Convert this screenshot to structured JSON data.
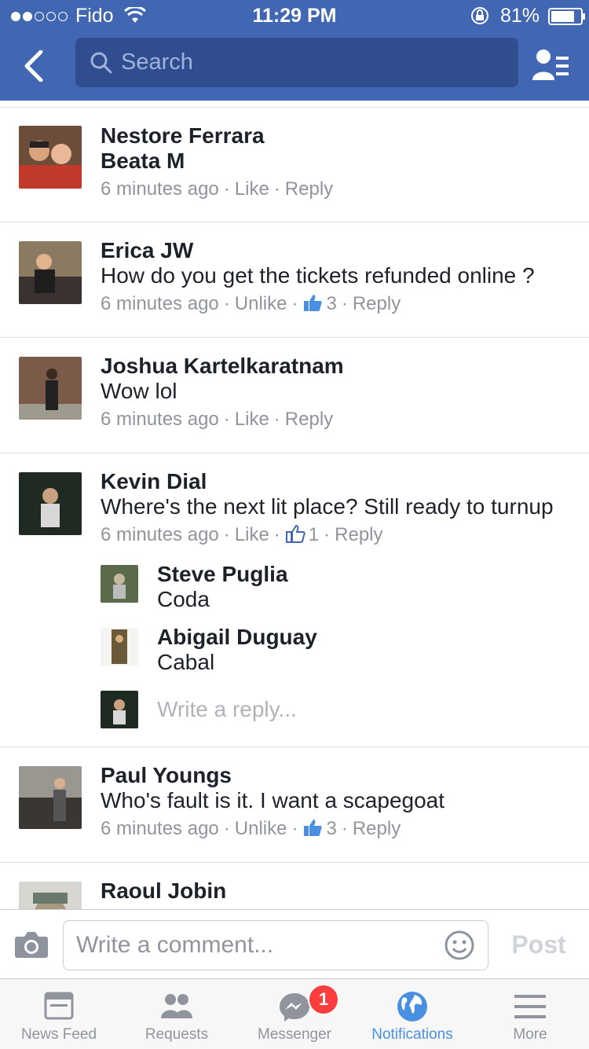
{
  "status_bar": {
    "carrier": "Fido",
    "time": "11:29 PM",
    "battery_percent": "81%",
    "battery_level": 0.81,
    "signal_bars_filled": 2,
    "signal_bars_total": 5
  },
  "nav": {
    "search_placeholder": "Search"
  },
  "comments": [
    {
      "name": "Nestore Ferrara",
      "text": "Beata M",
      "time": "6 minutes ago",
      "like": "Like",
      "likes": "",
      "reply": "Reply"
    },
    {
      "name": "Erica JW",
      "text": "How do you get the tickets refunded online ?",
      "time": "6 minutes ago",
      "like": "Unlike",
      "likes": "3",
      "reply": "Reply"
    },
    {
      "name": "Joshua Kartelkaratnam",
      "text": "Wow lol",
      "time": "6 minutes ago",
      "like": "Like",
      "likes": "",
      "reply": "Reply"
    },
    {
      "name": "Kevin Dial",
      "text": "Where's the next lit place? Still ready to turnup",
      "time": "6 minutes ago",
      "like": "Like",
      "likes": "1",
      "reply": "Reply",
      "replies": [
        {
          "name": "Steve Puglia",
          "text": "Coda"
        },
        {
          "name": "Abigail Duguay",
          "text": "Cabal"
        }
      ],
      "reply_placeholder": "Write a reply..."
    },
    {
      "name": "Paul Youngs",
      "text": "Who's fault is it. I want a scapegoat",
      "time": "6 minutes ago",
      "like": "Unlike",
      "likes": "3",
      "reply": "Reply"
    },
    {
      "name": "Raoul Jobin"
    }
  ],
  "composer": {
    "placeholder": "Write a comment...",
    "post_label": "Post"
  },
  "tabbar": {
    "tabs": [
      {
        "label": "News Feed",
        "active": false
      },
      {
        "label": "Requests",
        "active": false
      },
      {
        "label": "Messenger",
        "active": false,
        "badge": "1"
      },
      {
        "label": "Notifications",
        "active": true
      },
      {
        "label": "More",
        "active": false
      }
    ]
  },
  "colors": {
    "brand": "#4267b2",
    "active_tab": "#4a90e2",
    "badge": "#fa3e3e",
    "meta_text": "#90949c"
  }
}
